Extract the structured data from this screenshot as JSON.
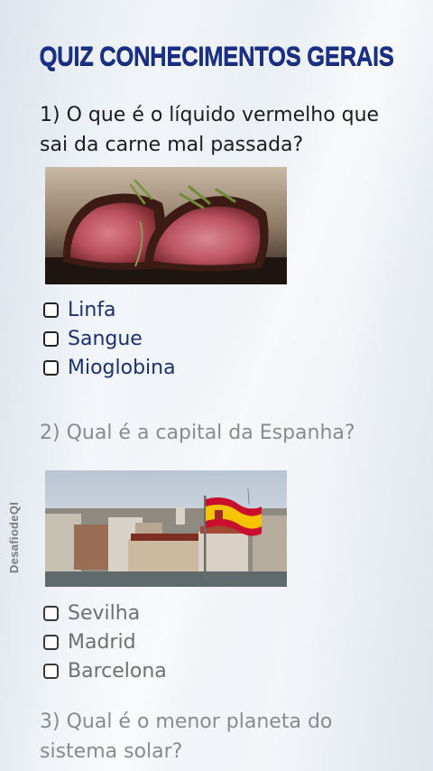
{
  "title": "QUIZ CONHECIMENTOS GERAIS",
  "watermark": "DesafiodeQI",
  "questions": [
    {
      "text": "1) O que é o líquido vermelho que sai da carne mal passada?",
      "image": "sliced-rare-steak",
      "options": [
        "Linfa",
        "Sangue",
        "Mioglobina"
      ]
    },
    {
      "text": "2) Qual é a capital da Espanha?",
      "image": "madrid-city-with-spanish-flag",
      "options": [
        "Sevilha",
        "Madrid",
        "Barcelona"
      ]
    },
    {
      "text": "3) Qual é o menor planeta do sistema solar?"
    }
  ],
  "colors": {
    "title": "#1a2f8a",
    "active_option": "#1c2f74",
    "inactive_text": "#8a8a8a"
  }
}
